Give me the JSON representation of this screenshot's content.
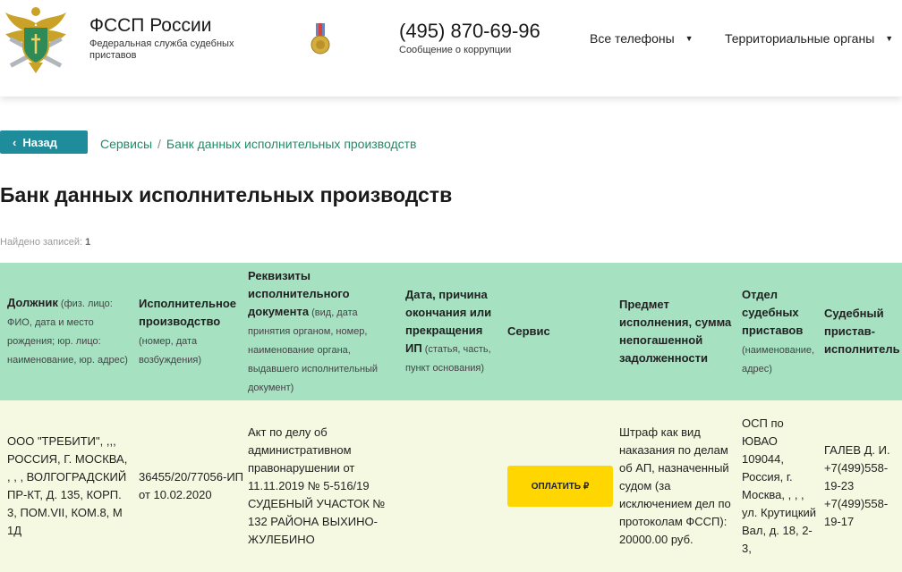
{
  "header": {
    "brand_title": "ФССП России",
    "brand_subtitle": "Федеральная служба судебных приставов",
    "phone": "(495) 870-69-96",
    "phone_caption": "Сообщение о коррупции",
    "nav": [
      {
        "label": "Все телефоны"
      },
      {
        "label": "Территориальные органы"
      }
    ]
  },
  "back_label": "Назад",
  "breadcrumb": {
    "items": [
      "Сервисы",
      "Банк данных исполнительных производств"
    ],
    "separator": "/"
  },
  "page_title": "Банк данных исполнительных производств",
  "found": {
    "label": "Найдено записей:",
    "count": "1"
  },
  "table": {
    "headers": [
      {
        "title": "Должник",
        "sub": " (физ. лицо: ФИО, дата и место рождения; юр. лицо: наименование, юр. адрес)"
      },
      {
        "title": "Исполнительное производство",
        "sub": " (номер, дата возбуждения)"
      },
      {
        "title": "Реквизиты исполнительного документа",
        "sub": " (вид, дата принятия органом, номер, наименование органа, выдавшего исполнительный документ)"
      },
      {
        "title": "Дата, причина окончания или прекращения ИП",
        "sub": " (статья, часть, пункт основания)"
      },
      {
        "title": "Сервис",
        "sub": ""
      },
      {
        "title": "Предмет исполнения, сумма непогашенной задолженности",
        "sub": ""
      },
      {
        "title": "Отдел судебных приставов",
        "sub": " (наименование, адрес)"
      },
      {
        "title": "Судебный пристав-исполнитель",
        "sub": ""
      }
    ],
    "row": {
      "debtor": "ООО \"ТРЕБИТИ\", ,,, РОССИЯ, Г. МОСКВА, , , , ВОЛГОГРАДСКИЙ ПР-КТ, Д. 135, КОРП. 3, ПОМ.VII, КОМ.8, М 1Д",
      "proceeding": "36455/20/77056-ИП от 10.02.2020",
      "document": "Акт по делу об административном правонарушении от 11.11.2019 № 5-516/19 СУДЕБНЫЙ УЧАСТОК № 132 РАЙОНА ВЫХИНО-ЖУЛЕБИНО",
      "end_reason": "",
      "pay_label": "ОПЛАТИТЬ ₽",
      "subject": "Штраф как вид наказания по делам об АП, назначенный судом (за исключением дел по протоколам ФССП): 20000.00 руб.",
      "department": "ОСП по ЮВАО 109044, Россия, г. Москва, , , , ул. Крутицкий Вал, д. 18, 2-3,",
      "bailiff": "ГАЛЕВ Д. И. +7(499)558-19-23 +7(499)558-19-17"
    }
  },
  "colors": {
    "accent": "#1e8c9a",
    "link": "#1e8c6a",
    "table_header": "#a6e1c2",
    "row_background": "#f5f9e2",
    "pay_button": "#ffd600"
  }
}
